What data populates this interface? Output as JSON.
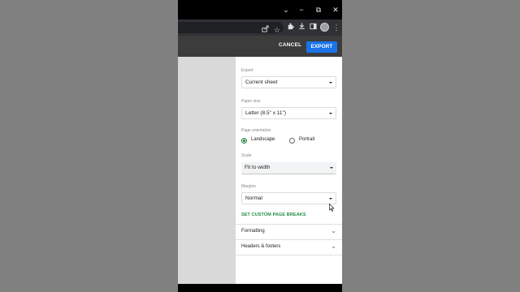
{
  "window": {
    "controls": {
      "chevron": "⌄",
      "minimize": "−",
      "restore": "⧉",
      "close": "✕"
    }
  },
  "browser_toolbar": {
    "icons": [
      "share-icon",
      "star-icon",
      "extensions-icon",
      "sidebar-icon",
      "download-icon",
      "avatar",
      "menu-icon"
    ]
  },
  "dialog": {
    "cancel_label": "CANCEL",
    "export_label": "EXPORT",
    "export": {
      "label": "Export",
      "value": "Current sheet"
    },
    "paper_size": {
      "label": "Paper size",
      "value": "Letter (8.5\" x 11\")"
    },
    "orientation": {
      "label": "Page orientation",
      "options": [
        {
          "label": "Landscape",
          "selected": true
        },
        {
          "label": "Portrait",
          "selected": false
        }
      ]
    },
    "scale": {
      "label": "Scale",
      "value": "Fit to width"
    },
    "margins": {
      "label": "Margins",
      "value": "Normal"
    },
    "custom_breaks_label": "SET CUSTOM PAGE BREAKS",
    "sections": [
      {
        "label": "Formatting"
      },
      {
        "label": "Headers & footers"
      }
    ]
  },
  "colors": {
    "accent_blue": "#1a73e8",
    "accent_green": "#188038"
  }
}
